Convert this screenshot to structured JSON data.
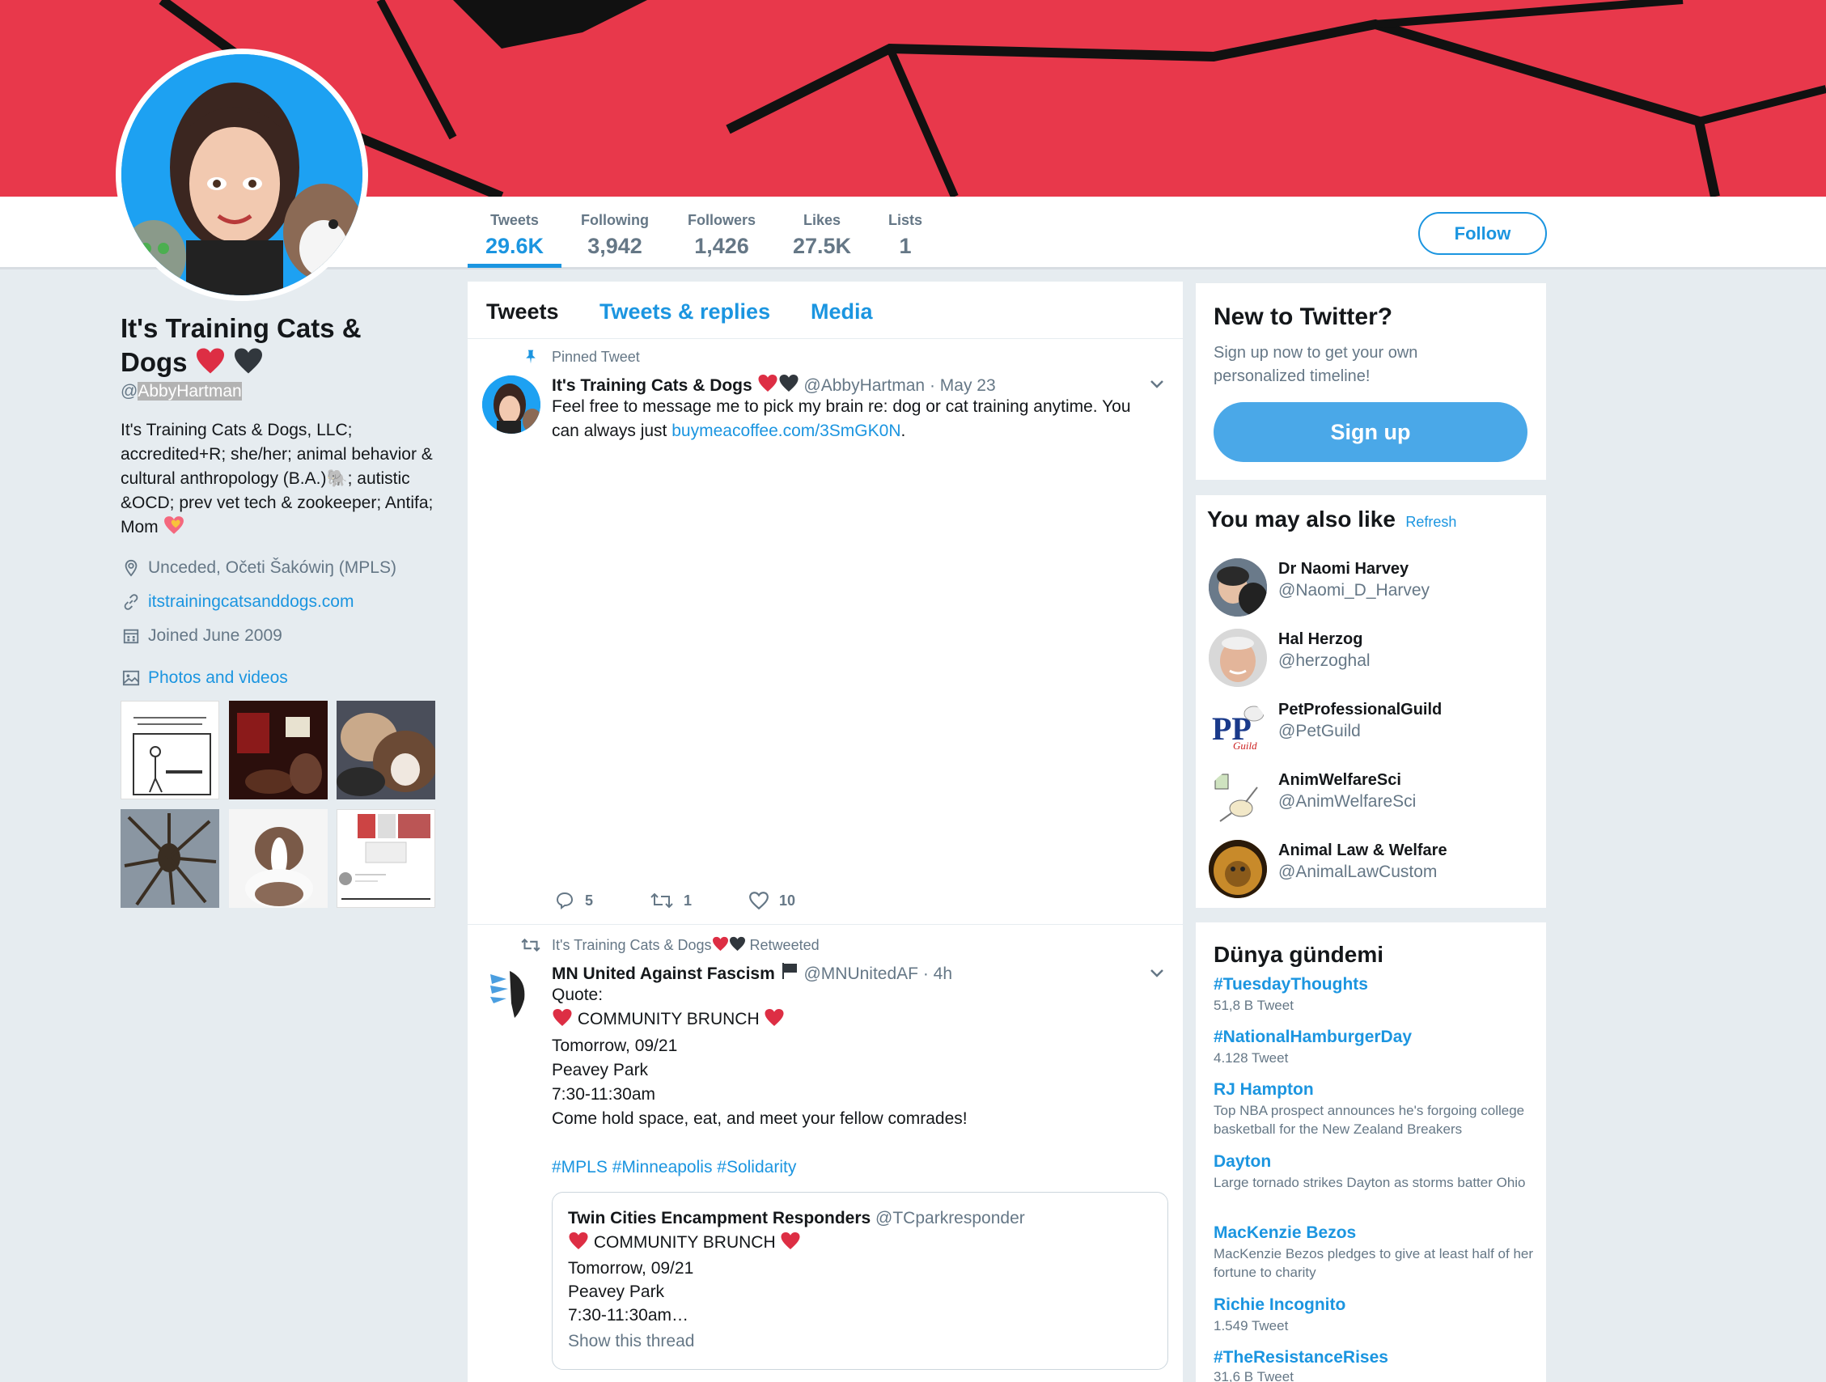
{
  "colors": {
    "accent": "#1b95e0",
    "banner": "#e8384b",
    "signup": "#4aa8e8"
  },
  "stats": [
    {
      "label": "Tweets",
      "value": "29.6K"
    },
    {
      "label": "Following",
      "value": "3,942"
    },
    {
      "label": "Followers",
      "value": "1,426"
    },
    {
      "label": "Likes",
      "value": "27.5K"
    },
    {
      "label": "Lists",
      "value": "1"
    }
  ],
  "follow_label": "Follow",
  "profile": {
    "name": "It's Training Cats & Dogs",
    "handle_at": "@",
    "handle": "AbbyHartman",
    "bio": "It's Training Cats & Dogs, LLC; accredited+R; she/her; animal behavior & cultural anthropology (B.A.)🐘; autistic &OCD; prev vet tech & zookeeper; Antifa; Mom",
    "location": "Unceded, Očeti Šakówiŋ (MPLS)",
    "website": "itstrainingcatsanddogs.com",
    "joined": "Joined June 2009",
    "photos_title": "Photos and videos"
  },
  "tabs": [
    "Tweets",
    "Tweets & replies",
    "Media"
  ],
  "pinned": {
    "context": "Pinned Tweet",
    "name": "It's Training Cats & Dogs",
    "handle": "@AbbyHartman",
    "time": "· May 23",
    "text": "Feel free to message me to pick my brain re: dog or cat training anytime.  You can always just ",
    "link": "buymeacoffee.com/3SmGK0N",
    "text_end": ".",
    "replies": "5",
    "retweets": "1",
    "likes": "10"
  },
  "retweet": {
    "context": "It's Training Cats & Dogs",
    "context_suffix": "Retweeted",
    "name": "MN United Against Fascism",
    "handle": "@MNUnitedAF",
    "time": "· 4h",
    "lines": [
      "Quote:",
      "COMMUNITY BRUNCH",
      "Tomorrow, 09/21",
      "Peavey Park",
      "7:30-11:30am",
      "Come hold space, eat, and meet your fellow comrades!"
    ],
    "hashtags": "#MPLS #Minneapolis #Solidarity",
    "quote": {
      "name": "Twin Cities Encampment Responders",
      "handle": "@TCparkresponder",
      "lines": [
        "COMMUNITY BRUNCH",
        "Tomorrow, 09/21",
        "Peavey Park",
        "7:30-11:30am…"
      ],
      "show_thread": "Show this thread"
    }
  },
  "new_to_twitter": {
    "title": "New to Twitter?",
    "text": "Sign up now to get your own personalized timeline!",
    "button": "Sign up"
  },
  "wtf": {
    "title": "You may also like",
    "refresh": "Refresh",
    "users": [
      {
        "name": "Dr Naomi Harvey",
        "handle": "@Naomi_D_Harvey"
      },
      {
        "name": "Hal Herzog",
        "handle": "@herzoghal"
      },
      {
        "name": "PetProfessionalGuild",
        "handle": "@PetGuild"
      },
      {
        "name": "AnimWelfareSci",
        "handle": "@AnimWelfareSci"
      },
      {
        "name": "Animal Law & Welfare",
        "handle": "@AnimalLawCustom"
      }
    ],
    "guild_logo_text": "Guild"
  },
  "trends": {
    "title": "Dünya gündemi",
    "items": [
      {
        "name": "#TuesdayThoughts",
        "sub": "51,8 B Tweet"
      },
      {
        "name": "#NationalHamburgerDay",
        "sub": "4.128 Tweet"
      },
      {
        "name": "RJ Hampton",
        "sub": "Top NBA prospect announces he's forgoing college basketball for the New Zealand Breakers"
      },
      {
        "name": "Dayton",
        "sub": "Large tornado strikes Dayton as storms batter Ohio"
      },
      {
        "name": "MacKenzie Bezos",
        "sub": "MacKenzie Bezos pledges to give at least half of her fortune to charity"
      },
      {
        "name": "Richie Incognito",
        "sub": "1.549 Tweet"
      },
      {
        "name": "#TheResistanceRises",
        "sub": "31,6 B Tweet"
      }
    ]
  }
}
